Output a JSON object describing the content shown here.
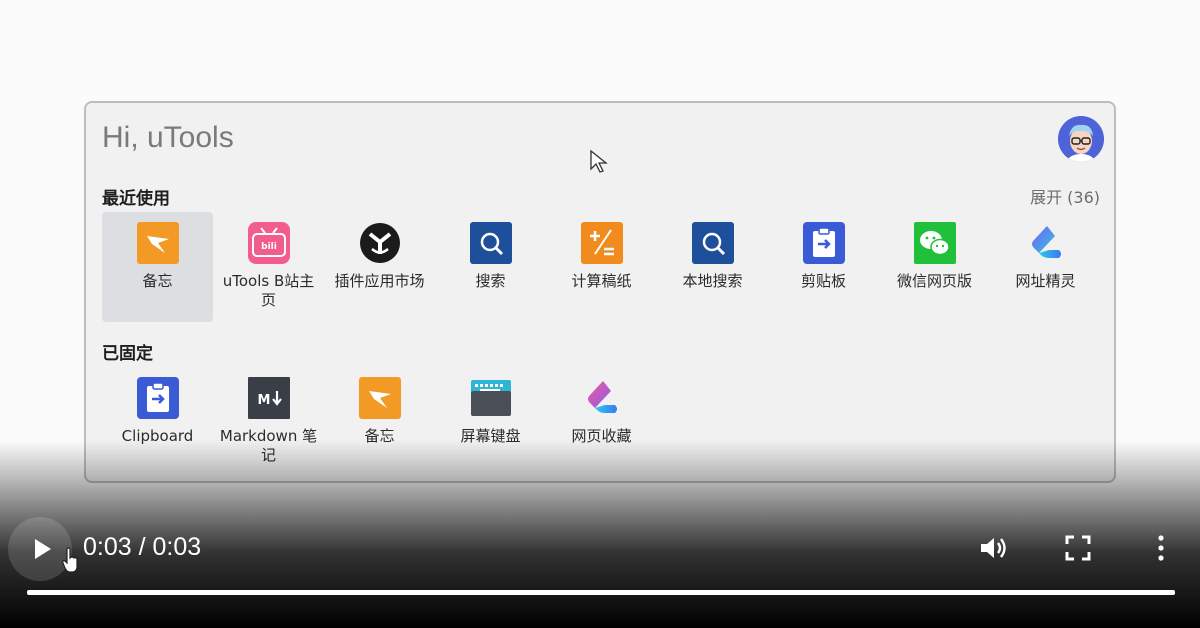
{
  "launcher": {
    "greeting": "Hi, uTools",
    "recent": {
      "title": "最近使用",
      "expand_label": "展开 (36)",
      "items": [
        {
          "label": "备忘",
          "icon": "memo-icon"
        },
        {
          "label": "uTools B站主页",
          "icon": "bilibili-icon"
        },
        {
          "label": "插件应用市场",
          "icon": "plugin-market-icon"
        },
        {
          "label": "搜索",
          "icon": "search-icon"
        },
        {
          "label": "计算稿纸",
          "icon": "calculator-icon"
        },
        {
          "label": "本地搜索",
          "icon": "local-search-icon"
        },
        {
          "label": "剪贴板",
          "icon": "clipboard-icon"
        },
        {
          "label": "微信网页版",
          "icon": "wechat-icon"
        },
        {
          "label": "网址精灵",
          "icon": "url-sprite-icon"
        }
      ]
    },
    "pinned": {
      "title": "已固定",
      "items": [
        {
          "label": "Clipboard",
          "icon": "clipboard-icon"
        },
        {
          "label": "Markdown 笔记",
          "icon": "markdown-icon"
        },
        {
          "label": "备忘",
          "icon": "memo-icon"
        },
        {
          "label": "屏幕键盘",
          "icon": "keyboard-icon"
        },
        {
          "label": "网页收藏",
          "icon": "bookmark-icon"
        }
      ]
    }
  },
  "player": {
    "time_display": "0:03 / 0:03",
    "progress_fraction": 1.0
  },
  "colors": {
    "memo": "#f39a26",
    "bilibili": "#f25d8e",
    "search": "#1e4f9a",
    "wechat": "#21c03a",
    "clipboard": "#3b5bd6"
  }
}
